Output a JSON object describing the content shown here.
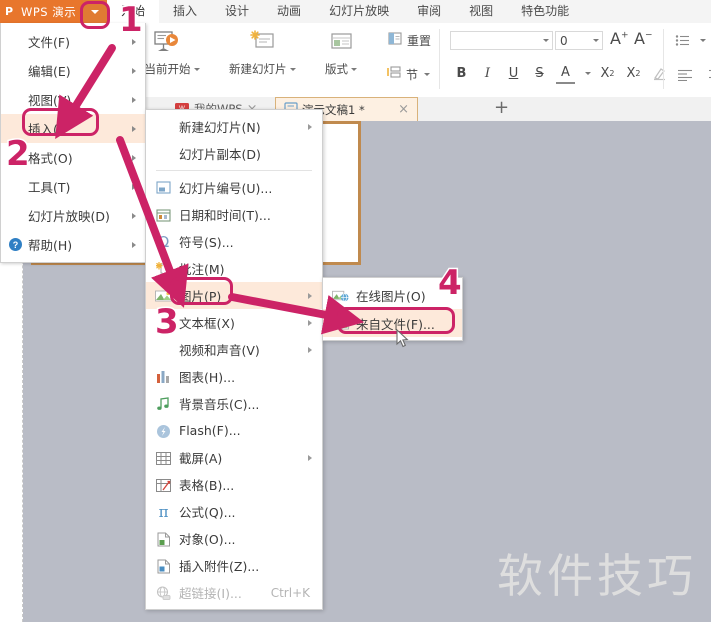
{
  "app": {
    "logo_text": "WPS 演示",
    "logo_glyph": "P",
    "caret_icon": "caret-down-icon"
  },
  "ribbon": {
    "tabs": [
      {
        "label": "开始",
        "active": true
      },
      {
        "label": "插入",
        "active": false
      },
      {
        "label": "设计",
        "active": false
      },
      {
        "label": "动画",
        "active": false
      },
      {
        "label": "幻灯片放映",
        "active": false
      },
      {
        "label": "审阅",
        "active": false
      },
      {
        "label": "视图",
        "active": false
      },
      {
        "label": "特色功能",
        "active": false
      }
    ],
    "big_buttons": [
      {
        "label": "从当前开始",
        "icon": "present-from-current-icon",
        "dropdown": true
      },
      {
        "label": "新建幻灯片",
        "icon": "new-slide-icon",
        "dropdown": true
      },
      {
        "label": "版式",
        "icon": "layout-icon",
        "dropdown": true
      }
    ],
    "reset_label": "重置",
    "section_label": "节",
    "font_name_value": "",
    "font_size_value": "0",
    "grow_font": "A",
    "shrink_font": "A",
    "format_buttons": [
      "B",
      "I",
      "U",
      "S",
      "A"
    ],
    "superscript": "X",
    "subscript": "X"
  },
  "doc_tabs": {
    "tabs": [
      {
        "label": "我的WPS",
        "active": false,
        "icon": "wps-cloud-icon",
        "close": "×"
      },
      {
        "label": "演示文稿1 *",
        "active": true,
        "icon": "presentation-icon",
        "close": "×"
      }
    ],
    "new_tab_label": "+"
  },
  "main_menu": {
    "items": [
      {
        "label": "文件(F)",
        "submenu": true,
        "icon": "",
        "highlight": false
      },
      {
        "label": "编辑(E)",
        "submenu": true,
        "icon": "",
        "highlight": false
      },
      {
        "label": "视图(V)",
        "submenu": true,
        "icon": "",
        "highlight": false
      },
      {
        "label": "插入(I)",
        "submenu": true,
        "icon": "",
        "highlight": true
      },
      {
        "label": "格式(O)",
        "submenu": true,
        "icon": "",
        "highlight": false
      },
      {
        "label": "工具(T)",
        "submenu": true,
        "icon": "",
        "highlight": false
      },
      {
        "label": "幻灯片放映(D)",
        "submenu": true,
        "icon": "",
        "highlight": false
      },
      {
        "label": "帮助(H)",
        "submenu": true,
        "icon": "help-icon",
        "highlight": false
      }
    ]
  },
  "insert_menu": {
    "items": [
      {
        "label": "新建幻灯片(N)",
        "icon": "",
        "submenu": true,
        "shortcut": "",
        "disabled": false,
        "highlight": false
      },
      {
        "label": "幻灯片副本(D)",
        "icon": "",
        "submenu": false,
        "shortcut": "",
        "disabled": false,
        "highlight": false
      },
      {
        "divider": true
      },
      {
        "label": "幻灯片编号(U)...",
        "icon": "slide-number-icon",
        "submenu": false,
        "shortcut": "",
        "disabled": false,
        "highlight": false
      },
      {
        "label": "日期和时间(T)...",
        "icon": "date-time-icon",
        "submenu": false,
        "shortcut": "",
        "disabled": false,
        "highlight": false
      },
      {
        "label": "符号(S)...",
        "icon": "symbol-omega-icon",
        "submenu": false,
        "shortcut": "",
        "disabled": false,
        "highlight": false
      },
      {
        "label": "批注(M)",
        "icon": "comment-icon",
        "submenu": false,
        "shortcut": "",
        "disabled": false,
        "highlight": false
      },
      {
        "label": "图片(P)",
        "icon": "picture-icon",
        "submenu": true,
        "shortcut": "",
        "disabled": false,
        "highlight": true
      },
      {
        "label": "文本框(X)",
        "icon": "",
        "submenu": true,
        "shortcut": "",
        "disabled": false,
        "highlight": false
      },
      {
        "label": "视频和声音(V)",
        "icon": "",
        "submenu": true,
        "shortcut": "",
        "disabled": false,
        "highlight": false
      },
      {
        "label": "图表(H)...",
        "icon": "chart-icon",
        "submenu": false,
        "shortcut": "",
        "disabled": false,
        "highlight": false
      },
      {
        "label": "背景音乐(C)...",
        "icon": "music-note-icon",
        "submenu": false,
        "shortcut": "",
        "disabled": false,
        "highlight": false
      },
      {
        "label": "Flash(F)...",
        "icon": "flash-icon",
        "submenu": false,
        "shortcut": "",
        "disabled": false,
        "highlight": false
      },
      {
        "label": "截屏(A)",
        "icon": "screenshot-icon",
        "submenu": true,
        "shortcut": "",
        "disabled": false,
        "highlight": false
      },
      {
        "label": "表格(B)...",
        "icon": "table-icon",
        "submenu": false,
        "shortcut": "",
        "disabled": false,
        "highlight": false
      },
      {
        "label": "公式(Q)...",
        "icon": "formula-pi-icon",
        "submenu": false,
        "shortcut": "",
        "disabled": false,
        "highlight": false
      },
      {
        "label": "对象(O)...",
        "icon": "object-icon",
        "submenu": false,
        "shortcut": "",
        "disabled": false,
        "highlight": false
      },
      {
        "label": "插入附件(Z)...",
        "icon": "attachment-icon",
        "submenu": false,
        "shortcut": "",
        "disabled": false,
        "highlight": false
      },
      {
        "label": "超链接(I)...",
        "icon": "hyperlink-icon",
        "submenu": false,
        "shortcut": "Ctrl+K",
        "disabled": true,
        "highlight": false
      }
    ]
  },
  "picture_menu": {
    "items": [
      {
        "label": "在线图片(O)",
        "icon": "online-picture-icon",
        "highlight": false
      },
      {
        "label": "来自文件(F)...",
        "icon": "from-file-icon",
        "highlight": true
      }
    ]
  },
  "annotations": {
    "steps": [
      {
        "number": "1"
      },
      {
        "number": "2"
      },
      {
        "number": "3"
      },
      {
        "number": "4"
      }
    ],
    "highlight_color": "#cc2366"
  },
  "watermark": {
    "text": "软件技巧"
  }
}
